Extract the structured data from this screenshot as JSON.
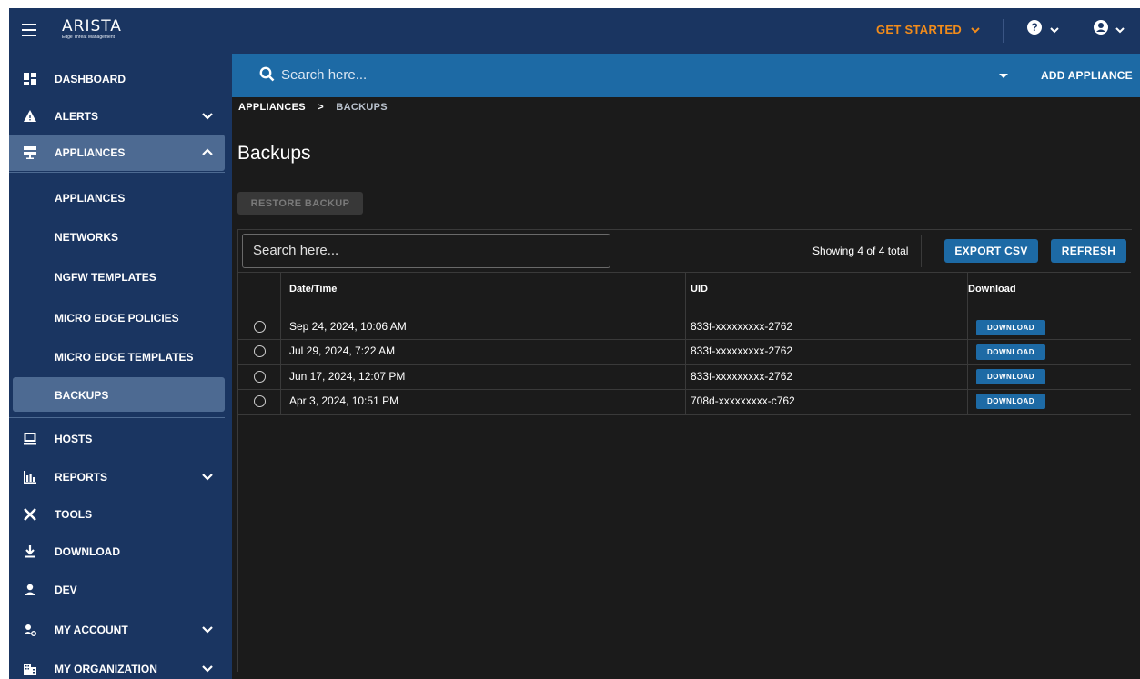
{
  "app": {
    "logo_text": "ARISTA",
    "logo_sub": "Edge Threat Management",
    "get_started": "GET STARTED"
  },
  "search": {
    "placeholder": "Search here...",
    "add_appliance": "ADD APPLIANCE"
  },
  "sidebar": {
    "items": [
      {
        "label": "DASHBOARD",
        "icon": "dashboard-icon"
      },
      {
        "label": "ALERTS",
        "icon": "alert-icon",
        "chevron": "down"
      },
      {
        "label": "APPLIANCES",
        "icon": "appliances-icon",
        "chevron": "up"
      },
      {
        "label": "HOSTS",
        "icon": "hosts-icon"
      },
      {
        "label": "REPORTS",
        "icon": "reports-icon",
        "chevron": "down"
      },
      {
        "label": "TOOLS",
        "icon": "tools-icon"
      },
      {
        "label": "DOWNLOAD",
        "icon": "download-icon"
      },
      {
        "label": "DEV",
        "icon": "dev-icon"
      },
      {
        "label": "MY ACCOUNT",
        "icon": "account-icon",
        "chevron": "down"
      },
      {
        "label": "MY ORGANIZATION",
        "icon": "organization-icon",
        "chevron": "down"
      }
    ],
    "sub_items": [
      {
        "label": "APPLIANCES"
      },
      {
        "label": "NETWORKS"
      },
      {
        "label": "NGFW TEMPLATES"
      },
      {
        "label": "MICRO EDGE POLICIES"
      },
      {
        "label": "MICRO EDGE TEMPLATES"
      },
      {
        "label": "BACKUPS",
        "active": true
      }
    ]
  },
  "breadcrumb": {
    "first": "APPLIANCES",
    "separator": ">",
    "last": "BACKUPS"
  },
  "page": {
    "title": "Backups",
    "restore_label": "RESTORE BACKUP"
  },
  "grid": {
    "search_placeholder": "Search here...",
    "showing": "Showing 4 of 4 total",
    "export_label": "EXPORT CSV",
    "refresh_label": "REFRESH",
    "columns": [
      "Date/Time",
      "UID",
      "Download"
    ],
    "download_label": "DOWNLOAD",
    "rows": [
      {
        "datetime": "Sep 24, 2024, 10:06 AM",
        "uid": "833f-xxxxxxxxx-2762"
      },
      {
        "datetime": "Jul 29, 2024, 7:22 AM",
        "uid": "833f-xxxxxxxxx-2762"
      },
      {
        "datetime": "Jun 17, 2024, 12:07 PM",
        "uid": "833f-xxxxxxxxx-2762"
      },
      {
        "datetime": "Apr 3, 2024, 10:51 PM",
        "uid": "708d-xxxxxxxxx-c762"
      }
    ]
  },
  "colors": {
    "sidebar_bg": "#1a3561",
    "accent_blue": "#1d6aa5",
    "active_item": "#4d6a92",
    "get_started": "#f28c1b",
    "content_bg": "#1b1b1b"
  }
}
